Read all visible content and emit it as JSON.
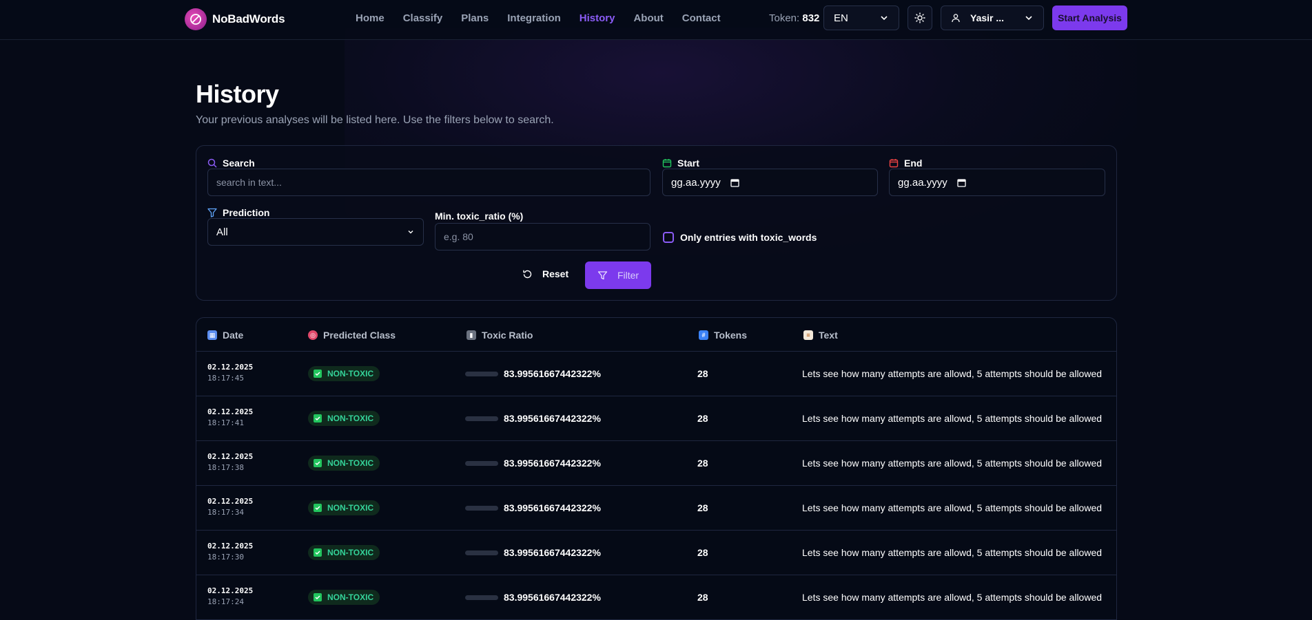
{
  "brand": {
    "name": "NoBadWords"
  },
  "nav": {
    "links": [
      "Home",
      "Classify",
      "Plans",
      "Integration",
      "History",
      "About",
      "Contact"
    ],
    "active": "History"
  },
  "token": {
    "label": "Token:",
    "value": "832"
  },
  "language": {
    "selected": "EN"
  },
  "user": {
    "name": "Yasir ..."
  },
  "start_button": "Start Analysis",
  "page": {
    "title": "History",
    "subtitle": "Your previous analyses will be listed here. Use the filters below to search."
  },
  "filters": {
    "search_label": "Search",
    "search_placeholder": "search in text...",
    "start_label": "Start",
    "start_value": "gg.aa.yyyy",
    "end_label": "End",
    "end_value": "gg.aa.yyyy",
    "prediction_label": "Prediction",
    "prediction_value": "All",
    "min_ratio_label": "Min. toxic_ratio (%)",
    "min_ratio_placeholder": "e.g. 80",
    "only_toxic_label": "Only entries with toxic_words",
    "reset_label": "Reset",
    "filter_label": "Filter"
  },
  "table": {
    "columns": [
      "Date",
      "Predicted Class",
      "Toxic Ratio",
      "Tokens",
      "Text"
    ],
    "rows": [
      {
        "date": "02.12.2025",
        "time": "18:17:45",
        "class": "NON-TOXIC",
        "ratio": "83.99561667442322%",
        "ratio_fraction": 0.84,
        "tokens": "28",
        "text": "Lets see how many attempts are allowd, 5 attempts should be allowed"
      },
      {
        "date": "02.12.2025",
        "time": "18:17:41",
        "class": "NON-TOXIC",
        "ratio": "83.99561667442322%",
        "ratio_fraction": 0.84,
        "tokens": "28",
        "text": "Lets see how many attempts are allowd, 5 attempts should be allowed"
      },
      {
        "date": "02.12.2025",
        "time": "18:17:38",
        "class": "NON-TOXIC",
        "ratio": "83.99561667442322%",
        "ratio_fraction": 0.84,
        "tokens": "28",
        "text": "Lets see how many attempts are allowd, 5 attempts should be allowed"
      },
      {
        "date": "02.12.2025",
        "time": "18:17:34",
        "class": "NON-TOXIC",
        "ratio": "83.99561667442322%",
        "ratio_fraction": 0.84,
        "tokens": "28",
        "text": "Lets see how many attempts are allowd, 5 attempts should be allowed"
      },
      {
        "date": "02.12.2025",
        "time": "18:17:30",
        "class": "NON-TOXIC",
        "ratio": "83.99561667442322%",
        "ratio_fraction": 0.84,
        "tokens": "28",
        "text": "Lets see how many attempts are allowd, 5 attempts should be allowed"
      },
      {
        "date": "02.12.2025",
        "time": "18:17:24",
        "class": "NON-TOXIC",
        "ratio": "83.99561667442322%",
        "ratio_fraction": 0.84,
        "tokens": "28",
        "text": "Lets see how many attempts are allowd, 5 attempts should be allowed"
      }
    ]
  },
  "colors": {
    "accent": "#7c3aed",
    "active_nav": "#8b5cf6",
    "toxic_bar": "#ef4444",
    "non_toxic": "#34d399"
  }
}
